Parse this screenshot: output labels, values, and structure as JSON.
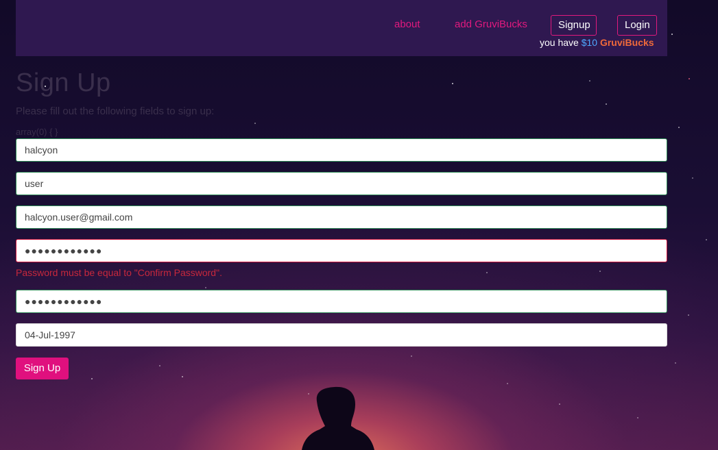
{
  "navbar": {
    "links": [
      {
        "label": "about"
      },
      {
        "label": "add GruviBucks"
      }
    ],
    "signup_label": "Signup",
    "login_label": "Login",
    "balance_prefix": "you have ",
    "balance_amount": "$10",
    "balance_brand": "GruviBucks"
  },
  "form": {
    "title": "Sign Up",
    "instructions": "Please fill out the following fields to sign up:",
    "debug_output": "array(0) { }",
    "first_name": "halcyon",
    "last_name": "user",
    "email": "halcyon.user@gmail.com",
    "password_mask": "●●●●●●●●●●●●",
    "password_error": "Password must be equal to \"Confirm Password\".",
    "confirm_password_mask": "●●●●●●●●●●●●",
    "date_of_birth": "04-Jul-1997",
    "submit_label": "Sign Up"
  },
  "colors": {
    "accent": "#e2197e",
    "navbar_bg": "#2f1850",
    "balance_amount": "#4ea8ff",
    "brand": "#f06a3a",
    "error": "#c8283c",
    "valid_border": "#2e8b57"
  }
}
